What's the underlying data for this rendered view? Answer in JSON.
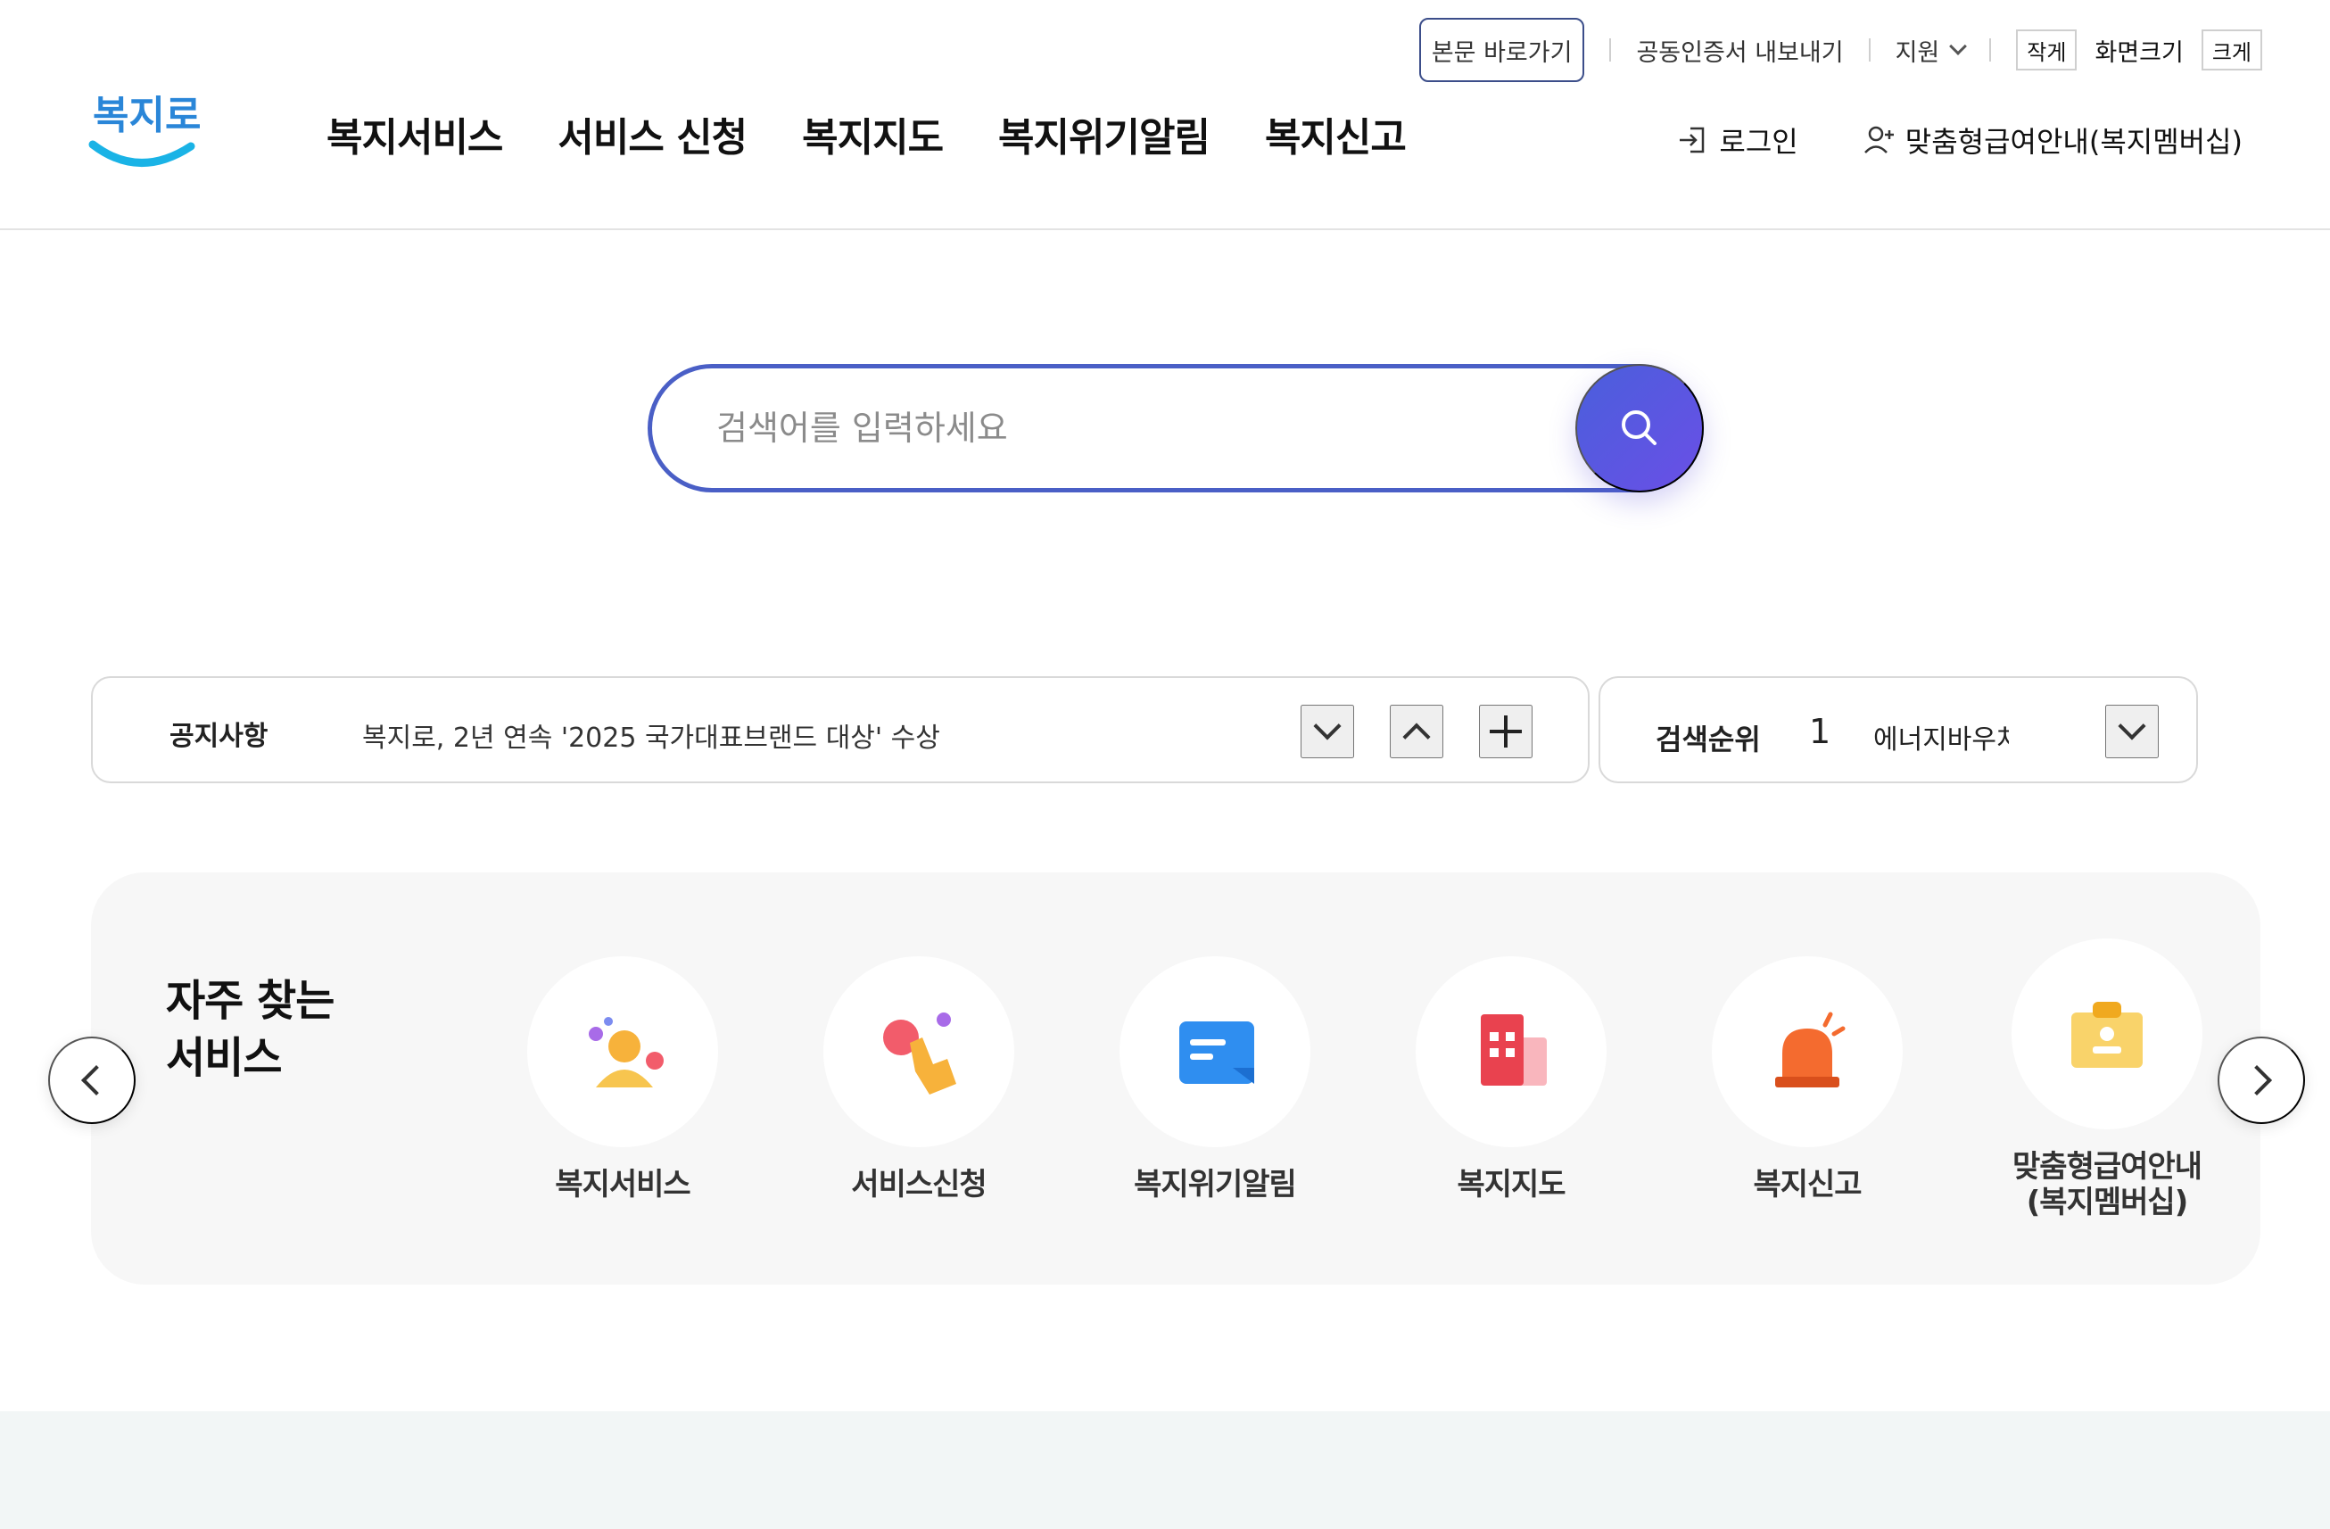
{
  "header": {
    "logo_text": "복지로",
    "utility": {
      "skip_to_content": "본문 바로가기",
      "export_certificate": "공동인증서 내보내기",
      "support": "지원",
      "font_small": "작게",
      "font_label": "화면크기",
      "font_large": "크게"
    },
    "nav": [
      {
        "label": "복지서비스"
      },
      {
        "label": "서비스 신청"
      },
      {
        "label": "복지지도"
      },
      {
        "label": "복지위기알림"
      },
      {
        "label": "복지신고"
      }
    ],
    "login_label": "로그인",
    "membership_label": "맞춤형급여안내(복지멤버십)"
  },
  "search": {
    "placeholder": "검색어를 입력하세요"
  },
  "notice": {
    "title": "공지사항",
    "text": "복지로, 2년 연속 '2025 국가대표브랜드 대상' 수상"
  },
  "ranking": {
    "title": "검색순위",
    "rank": "1",
    "keyword": "에너지바우처"
  },
  "frequent": {
    "title_line1": "자주 찾는",
    "title_line2": "서비스",
    "items": [
      {
        "label": "복지서비스",
        "icon": "people-icon"
      },
      {
        "label": "서비스신청",
        "icon": "hand-tap-icon"
      },
      {
        "label": "복지위기알림",
        "icon": "message-icon"
      },
      {
        "label": "복지지도",
        "icon": "building-icon"
      },
      {
        "label": "복지신고",
        "icon": "siren-icon"
      },
      {
        "label_line1": "맞춤형급여안내",
        "label_line2": "(복지멤버십)",
        "icon": "id-card-icon"
      }
    ]
  },
  "colors": {
    "accent": "#4a5fc6",
    "logo_blue": "#1ab3e6",
    "panel_bg": "#f7f7f7"
  }
}
